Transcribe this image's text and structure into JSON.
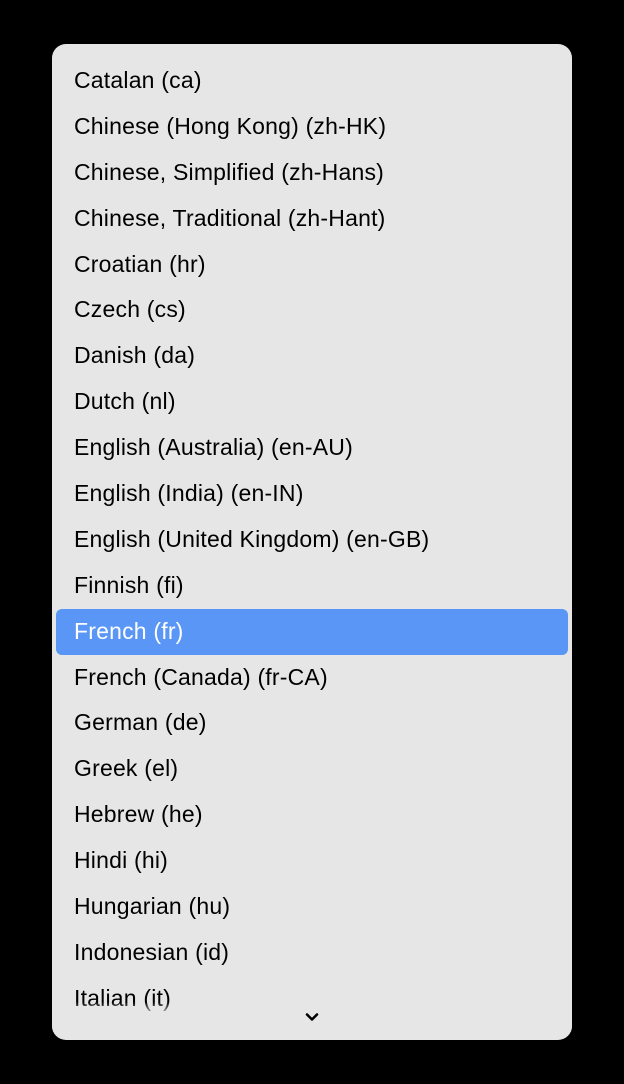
{
  "dropdown": {
    "options": [
      {
        "label": "Catalan (ca)",
        "selected": false
      },
      {
        "label": "Chinese (Hong Kong) (zh-HK)",
        "selected": false
      },
      {
        "label": "Chinese, Simplified (zh-Hans)",
        "selected": false
      },
      {
        "label": "Chinese, Traditional (zh-Hant)",
        "selected": false
      },
      {
        "label": "Croatian (hr)",
        "selected": false
      },
      {
        "label": "Czech (cs)",
        "selected": false
      },
      {
        "label": "Danish (da)",
        "selected": false
      },
      {
        "label": "Dutch (nl)",
        "selected": false
      },
      {
        "label": "English (Australia) (en-AU)",
        "selected": false
      },
      {
        "label": "English (India) (en-IN)",
        "selected": false
      },
      {
        "label": "English (United Kingdom) (en-GB)",
        "selected": false
      },
      {
        "label": "Finnish (fi)",
        "selected": false
      },
      {
        "label": "French (fr)",
        "selected": true
      },
      {
        "label": "French (Canada) (fr-CA)",
        "selected": false
      },
      {
        "label": "German (de)",
        "selected": false
      },
      {
        "label": "Greek (el)",
        "selected": false
      },
      {
        "label": "Hebrew (he)",
        "selected": false
      },
      {
        "label": "Hindi (hi)",
        "selected": false
      },
      {
        "label": "Hungarian (hu)",
        "selected": false
      },
      {
        "label": "Indonesian (id)",
        "selected": false
      },
      {
        "label": "Italian (it)",
        "selected": false
      }
    ]
  }
}
